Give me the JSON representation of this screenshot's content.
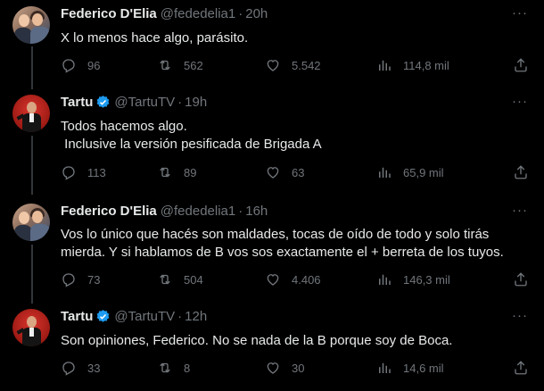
{
  "tweets": [
    {
      "name": "Federico D'Elia",
      "handle": "@fededelia1",
      "time": "20h",
      "verified": false,
      "text": "X lo menos hace algo, parásito.",
      "replies": "96",
      "retweets": "562",
      "likes": "5.542",
      "views": "114,8 mil"
    },
    {
      "name": "Tartu",
      "handle": "@TartuTV",
      "time": "19h",
      "verified": true,
      "text": "Todos hacemos algo.\n Inclusive la versión pesificada de Brigada A",
      "replies": "113",
      "retweets": "89",
      "likes": "63",
      "views": "65,9 mil"
    },
    {
      "name": "Federico D'Elia",
      "handle": "@fededelia1",
      "time": "16h",
      "verified": false,
      "text": "Vos lo único que hacés son maldades, tocas de oído de todo y solo tirás\nmierda. Y si hablamos de B vos sos exactamente el + berreta de los tuyos.",
      "replies": "73",
      "retweets": "504",
      "likes": "4.406",
      "views": "146,3 mil"
    },
    {
      "name": "Tartu",
      "handle": "@TartuTV",
      "time": "12h",
      "verified": true,
      "text": "Son opiniones, Federico. No se nada de la B porque soy de Boca.",
      "replies": "33",
      "retweets": "8",
      "likes": "30",
      "views": "14,6 mil"
    }
  ],
  "ui": {
    "dot": "·",
    "more": "···"
  },
  "colors": {
    "background": "#000000",
    "text": "#e7e9ea",
    "muted": "#71767b",
    "verified": "#1d9bf0"
  },
  "icons": {
    "reply": "reply-icon",
    "retweet": "retweet-icon",
    "like": "heart-icon",
    "views": "views-icon",
    "share": "share-icon",
    "more": "more-icon",
    "verified": "verified-badge-icon"
  }
}
